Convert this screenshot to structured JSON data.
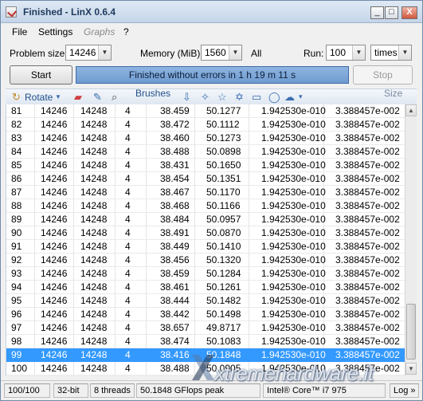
{
  "window": {
    "title": "Finished - LinX 0.6.4",
    "min_glyph": "_",
    "max_glyph": "□",
    "close_glyph": "X"
  },
  "menu": [
    "File",
    "Settings",
    "Graphs",
    "?"
  ],
  "controls": {
    "problem_size_label": "Problem size:",
    "problem_size_value": "14246",
    "memory_label": "Memory (MiB):",
    "memory_value": "1560",
    "all_label": "All",
    "run_label": "Run:",
    "run_value": "100",
    "run_unit": "times"
  },
  "buttons": {
    "start": "Start",
    "stop": "Stop"
  },
  "status_message": "Finished without errors in 1 h 19 m 11 s",
  "ribbon": {
    "rotate": "Rotate",
    "brushes": "Brushes",
    "size": "Size"
  },
  "rows": [
    [
      "81",
      "14246",
      "14248",
      "4",
      "38.459",
      "50.1277",
      "1.942530e-010",
      "3.388457e-002"
    ],
    [
      "82",
      "14246",
      "14248",
      "4",
      "38.472",
      "50.1112",
      "1.942530e-010",
      "3.388457e-002"
    ],
    [
      "83",
      "14246",
      "14248",
      "4",
      "38.460",
      "50.1273",
      "1.942530e-010",
      "3.388457e-002"
    ],
    [
      "84",
      "14246",
      "14248",
      "4",
      "38.488",
      "50.0898",
      "1.942530e-010",
      "3.388457e-002"
    ],
    [
      "85",
      "14246",
      "14248",
      "4",
      "38.431",
      "50.1650",
      "1.942530e-010",
      "3.388457e-002"
    ],
    [
      "86",
      "14246",
      "14248",
      "4",
      "38.454",
      "50.1351",
      "1.942530e-010",
      "3.388457e-002"
    ],
    [
      "87",
      "14246",
      "14248",
      "4",
      "38.467",
      "50.1170",
      "1.942530e-010",
      "3.388457e-002"
    ],
    [
      "88",
      "14246",
      "14248",
      "4",
      "38.468",
      "50.1166",
      "1.942530e-010",
      "3.388457e-002"
    ],
    [
      "89",
      "14246",
      "14248",
      "4",
      "38.484",
      "50.0957",
      "1.942530e-010",
      "3.388457e-002"
    ],
    [
      "90",
      "14246",
      "14248",
      "4",
      "38.491",
      "50.0870",
      "1.942530e-010",
      "3.388457e-002"
    ],
    [
      "91",
      "14246",
      "14248",
      "4",
      "38.449",
      "50.1410",
      "1.942530e-010",
      "3.388457e-002"
    ],
    [
      "92",
      "14246",
      "14248",
      "4",
      "38.456",
      "50.1320",
      "1.942530e-010",
      "3.388457e-002"
    ],
    [
      "93",
      "14246",
      "14248",
      "4",
      "38.459",
      "50.1284",
      "1.942530e-010",
      "3.388457e-002"
    ],
    [
      "94",
      "14246",
      "14248",
      "4",
      "38.461",
      "50.1261",
      "1.942530e-010",
      "3.388457e-002"
    ],
    [
      "95",
      "14246",
      "14248",
      "4",
      "38.444",
      "50.1482",
      "1.942530e-010",
      "3.388457e-002"
    ],
    [
      "96",
      "14246",
      "14248",
      "4",
      "38.442",
      "50.1498",
      "1.942530e-010",
      "3.388457e-002"
    ],
    [
      "97",
      "14246",
      "14248",
      "4",
      "38.657",
      "49.8717",
      "1.942530e-010",
      "3.388457e-002"
    ],
    [
      "98",
      "14246",
      "14248",
      "4",
      "38.474",
      "50.1083",
      "1.942530e-010",
      "3.388457e-002"
    ],
    [
      "99",
      "14246",
      "14248",
      "4",
      "38.416",
      "50.1848",
      "1.942530e-010",
      "3.388457e-002"
    ],
    [
      "100",
      "14246",
      "14248",
      "4",
      "38.488",
      "50.0905",
      "1.942530e-010",
      "3.388457e-002"
    ]
  ],
  "selected_row": "99",
  "statusbar": {
    "progress": "100/100",
    "bits": "32-bit",
    "threads": "8 threads",
    "peak": "50.1848 GFlops peak",
    "cpu": "Intel® Core™ i7 975",
    "log": "Log"
  },
  "watermark": "xtremehardware.it",
  "colors": {
    "selection": "#3399ff",
    "status_fill": "#7aa5d8",
    "title_text": "#1e3a5c"
  }
}
